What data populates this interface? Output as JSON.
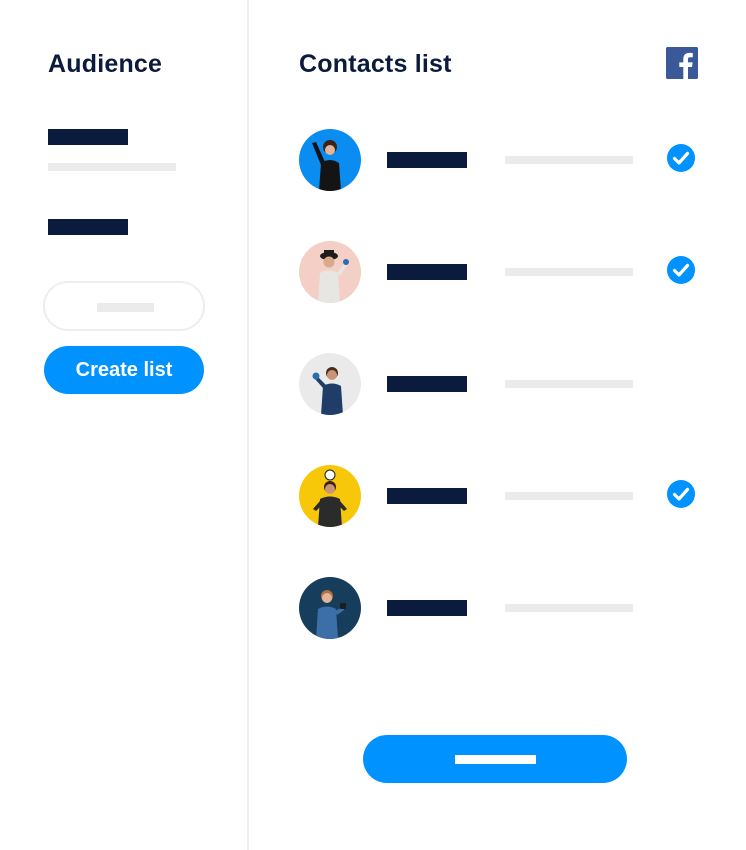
{
  "sidebar": {
    "title": "Audience",
    "create_button_label": "Create list"
  },
  "main": {
    "title": "Contacts list",
    "social_icon": "facebook-icon",
    "contacts": [
      {
        "avatar_bg": "#0a8cf0",
        "checked": true
      },
      {
        "avatar_bg": "#f4cfc6",
        "checked": true
      },
      {
        "avatar_bg": "#eaeaea",
        "checked": false
      },
      {
        "avatar_bg": "#f7c80a",
        "checked": true
      },
      {
        "avatar_bg": "#163d5c",
        "checked": false
      }
    ]
  },
  "colors": {
    "accent": "#0092ff",
    "navy": "#0b1b3d",
    "placeholder": "#ebebeb",
    "facebook": "#3b5998"
  }
}
